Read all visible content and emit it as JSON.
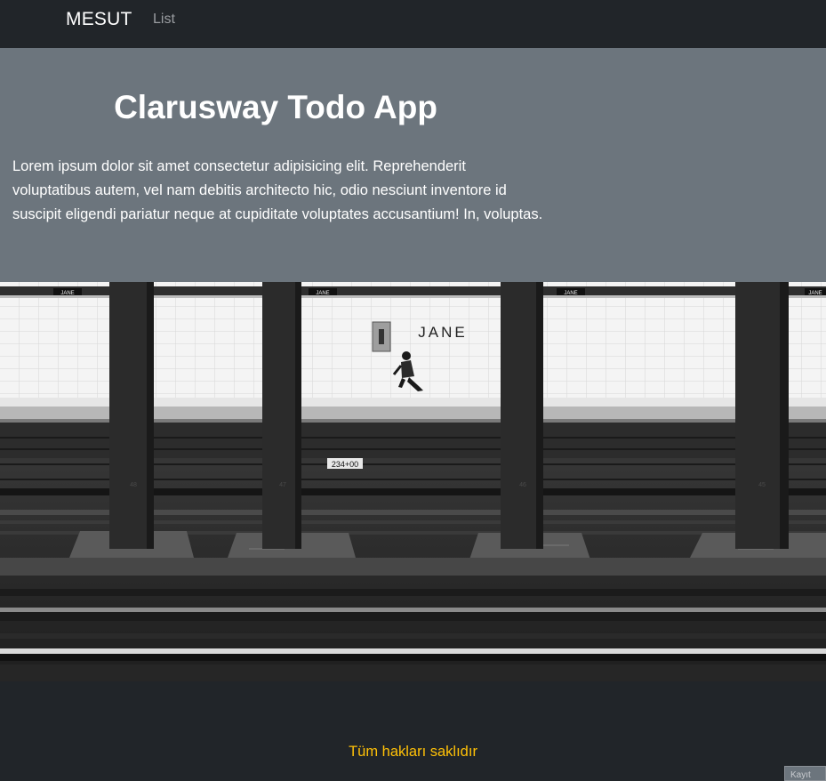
{
  "navbar": {
    "brand": "MESUT",
    "links": [
      {
        "label": "List"
      }
    ]
  },
  "hero": {
    "title": "Clarusway Todo App",
    "text": "Lorem ipsum dolor sit amet consectetur adipisicing elit. Reprehenderit voluptatibus autem, vel nam debitis architecto hic, odio nesciunt inventore id suscipit eligendi pariatur neque at cupiditate voluptates accusantium! In, voluptas."
  },
  "photo": {
    "station_sign": "JANE",
    "small_signs": [
      "JANE",
      "JANE",
      "JANE",
      "JANE"
    ],
    "track_marker": "234+00",
    "column_numbers": [
      "48",
      "47",
      "46",
      "45"
    ]
  },
  "footer": {
    "text": "Tüm hakları saklıdır",
    "corner_button": "Kayıt"
  },
  "colors": {
    "navbar_bg": "#212529",
    "hero_bg": "#6c757d",
    "footer_text": "#ffc107"
  }
}
